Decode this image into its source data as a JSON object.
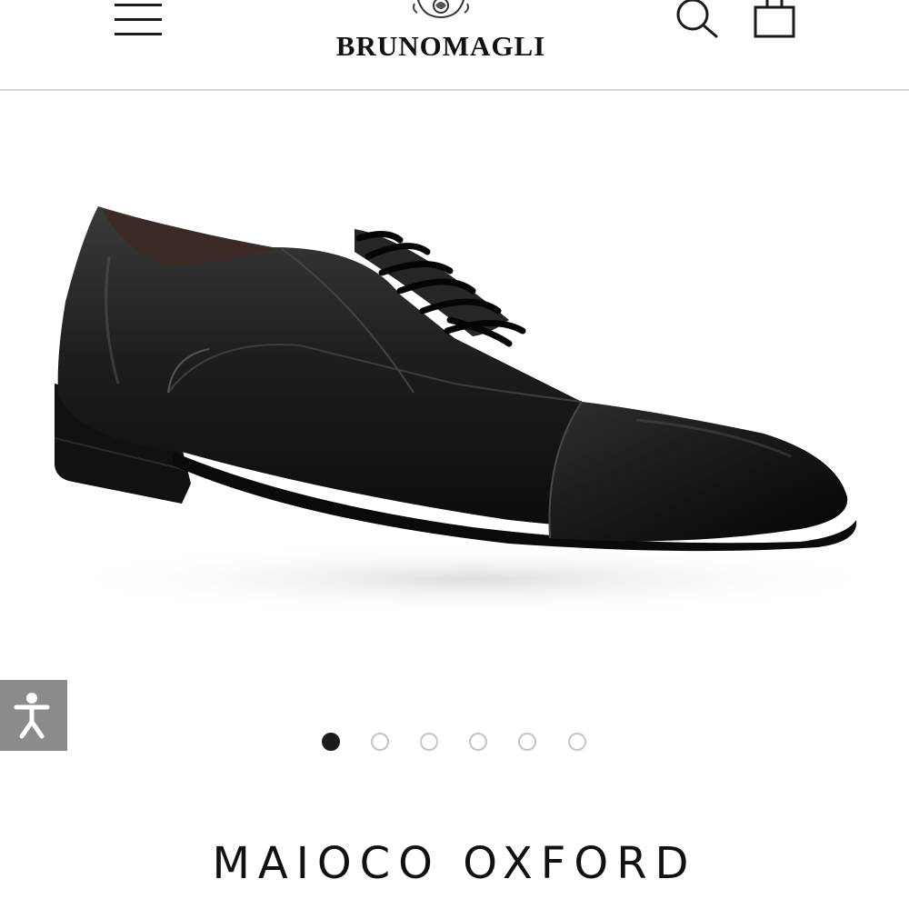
{
  "header": {
    "brand": "BRUNOMAGLI",
    "menu_icon": "hamburger-menu-icon",
    "search_icon": "search-icon",
    "bag_icon": "shopping-bag-icon"
  },
  "product": {
    "name": "MAIOCO OXFORD",
    "image_icon": "black-leather-oxford-shoe-image"
  },
  "gallery": {
    "dots": [
      {
        "active": true
      },
      {
        "active": false
      },
      {
        "active": false
      },
      {
        "active": false
      },
      {
        "active": false
      },
      {
        "active": false
      }
    ]
  },
  "accessibility": {
    "icon": "accessibility-person-icon",
    "background": "#8b8b8b"
  },
  "colors": {
    "text": "#111111",
    "divider": "#d8d8d8",
    "dot_active": "#1a1a1a",
    "dot_inactive": "#c4c4c4"
  }
}
